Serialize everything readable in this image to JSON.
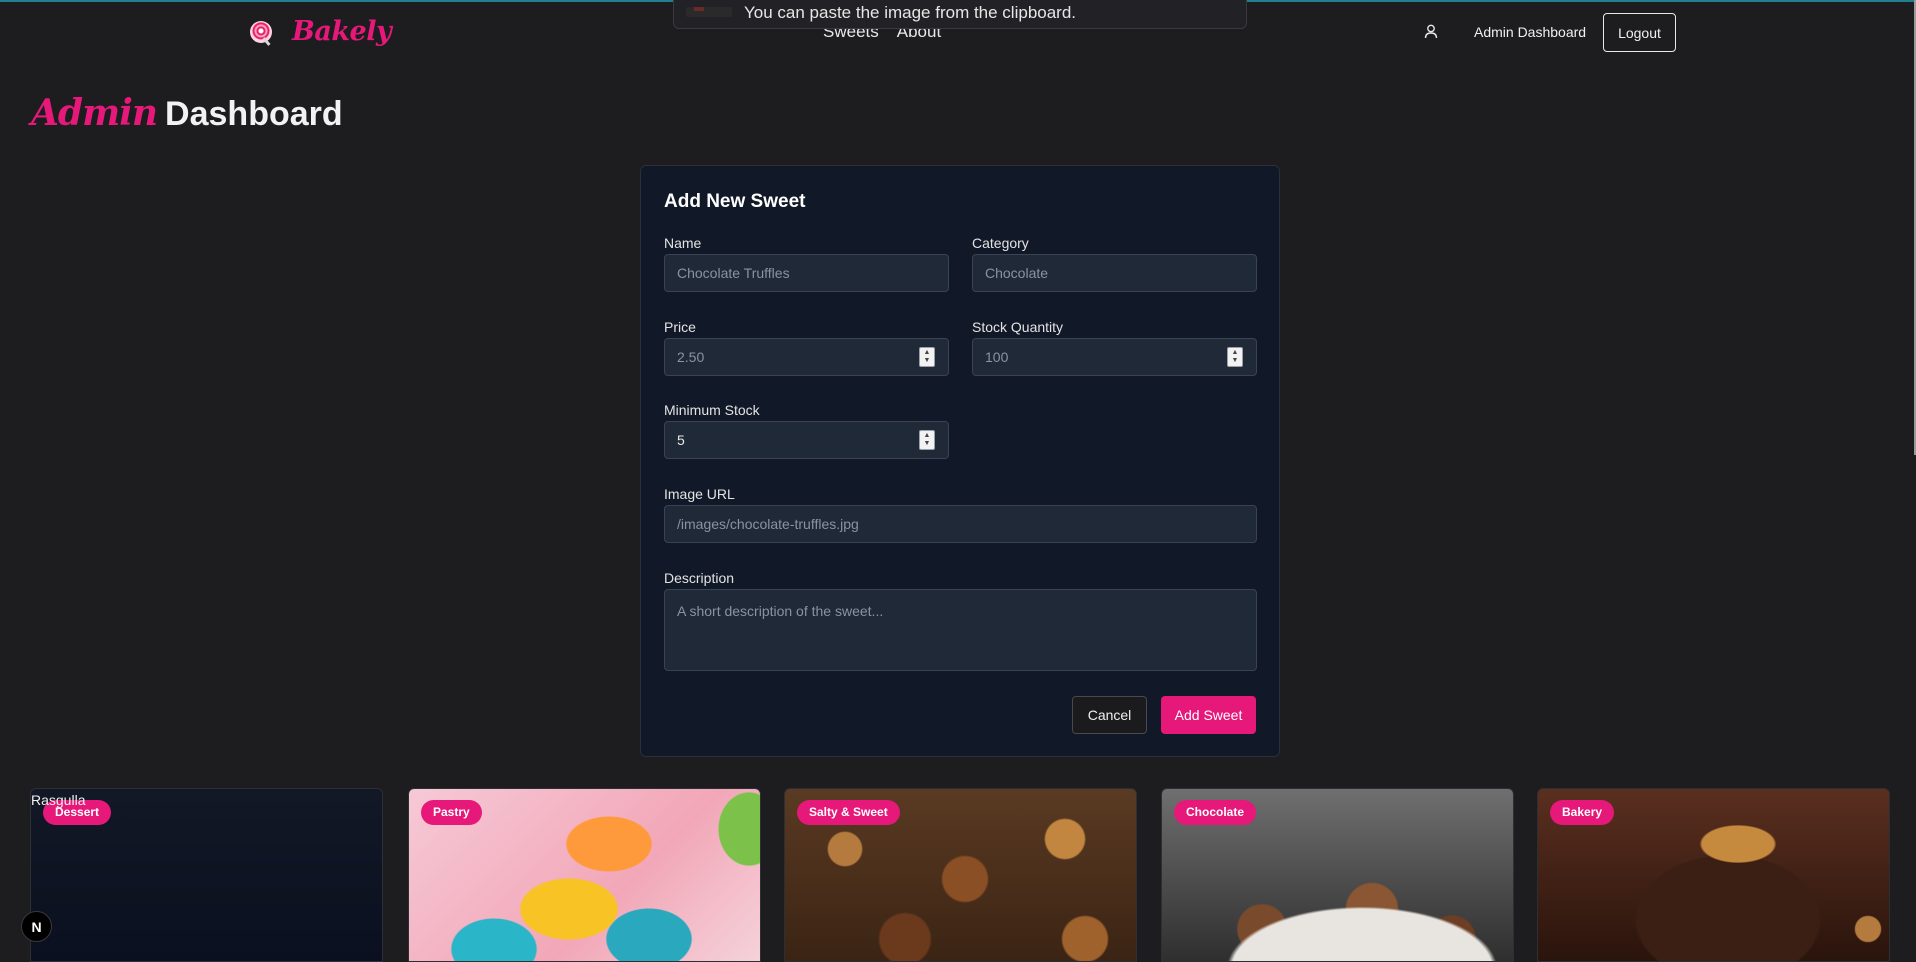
{
  "toast": {
    "text": "You can paste the image from the clipboard."
  },
  "nav": {
    "brand": "Bakely",
    "links": [
      "Sweets",
      "About"
    ],
    "admin_link": "Admin Dashboard",
    "logout_label": "Logout"
  },
  "page": {
    "title_script": "Admin",
    "title_main": "Dashboard"
  },
  "form": {
    "title": "Add New Sweet",
    "name": {
      "label": "Name",
      "placeholder": "Chocolate Truffles",
      "value": ""
    },
    "category": {
      "label": "Category",
      "placeholder": "Chocolate",
      "value": ""
    },
    "price": {
      "label": "Price",
      "placeholder": "2.50",
      "value": ""
    },
    "stock": {
      "label": "Stock Quantity",
      "placeholder": "100",
      "value": ""
    },
    "min_stock": {
      "label": "Minimum Stock",
      "placeholder": "",
      "value": "5"
    },
    "image_url": {
      "label": "Image URL",
      "placeholder": "/images/chocolate-truffles.jpg",
      "value": ""
    },
    "description": {
      "label": "Description",
      "placeholder": "A short description of the sweet...",
      "value": ""
    },
    "cancel_label": "Cancel",
    "submit_label": "Add Sweet"
  },
  "products": [
    {
      "name": "Rasgulla",
      "category": "Dessert"
    },
    {
      "category": "Pastry"
    },
    {
      "category": "Salty & Sweet"
    },
    {
      "category": "Chocolate"
    },
    {
      "category": "Bakery"
    }
  ],
  "dev_badge": "N",
  "colors": {
    "accent": "#e6187a",
    "background": "#1d1d1f",
    "card": "#111827"
  },
  "icons": {
    "search": "lollipop-icon",
    "user": "user-icon"
  }
}
